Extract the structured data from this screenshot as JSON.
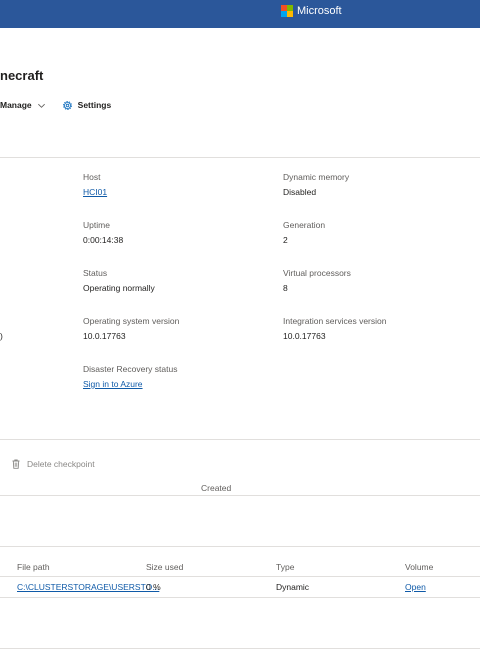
{
  "topbar": {
    "brand": "Microsoft",
    "logo_colors": [
      "#f25022",
      "#7fba00",
      "#00a4ef",
      "#ffb900"
    ]
  },
  "page": {
    "title": "necraft"
  },
  "toolbar": {
    "manage_label": "Manage",
    "settings_label": "Settings"
  },
  "details": {
    "host": {
      "label": "Host",
      "value": "HCI01"
    },
    "dynamic_memory": {
      "label": "Dynamic memory",
      "value": "Disabled"
    },
    "uptime": {
      "label": "Uptime",
      "value": "0:00:14:38"
    },
    "generation": {
      "label": "Generation",
      "value": "2"
    },
    "status": {
      "label": "Status",
      "value": "Operating normally"
    },
    "virtual_processors": {
      "label": "Virtual processors",
      "value": "8"
    },
    "os_version": {
      "label": "Operating system version",
      "value": "10.0.17763"
    },
    "integration_version": {
      "label": "Integration services version",
      "value": "10.0.17763"
    },
    "disaster_recovery": {
      "label": "Disaster Recovery status",
      "value": "Sign in to Azure"
    },
    "edge_fragment": ")"
  },
  "checkpoints": {
    "delete_label": "Delete checkpoint",
    "created_header": "Created"
  },
  "disks": {
    "headers": [
      "File path",
      "Size used",
      "Type",
      "Volume"
    ],
    "rows": [
      {
        "file_path": "C:\\CLUSTERSTORAGE\\USERSTO...",
        "size_used": "0 %",
        "type": "Dynamic",
        "volume": "Open"
      }
    ]
  }
}
